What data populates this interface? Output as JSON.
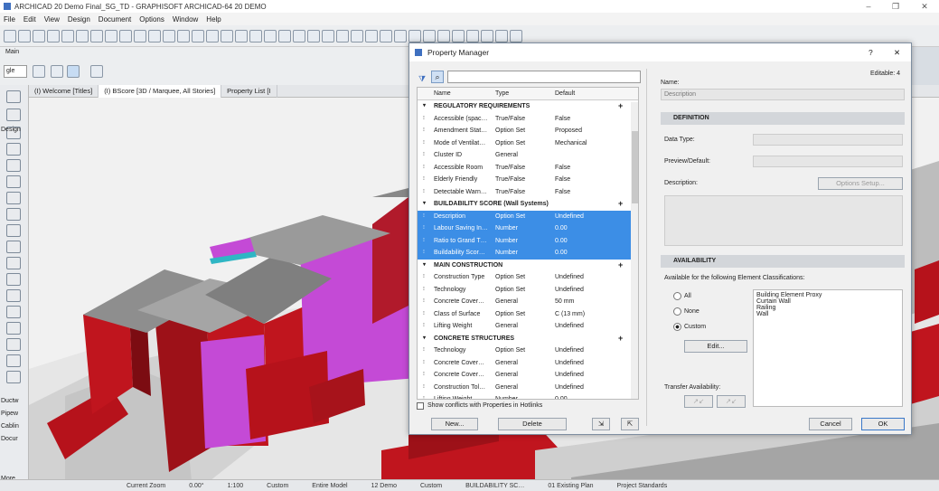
{
  "app": {
    "title": "ARCHICAD 20 Demo Final_SG_TD - GRAPHISOFT ARCHICAD-64 20 DEMO"
  },
  "menu": [
    "File",
    "Edit",
    "View",
    "Design",
    "Document",
    "Options",
    "Window",
    "Help"
  ],
  "toolbar": {
    "main_label": "Main",
    "layer_value": "gle"
  },
  "tabs": [
    "(I) Welcome [Titles]",
    "(I) BScore [3D / Marquee, All Stories]",
    "Property List [I"
  ],
  "palette": {
    "labels": [
      "Design",
      "Ductw",
      "Pipew",
      "Cablin",
      "Docur",
      "More"
    ]
  },
  "dialog": {
    "title": "Property Manager",
    "help": "?",
    "close": "✕",
    "search_placeholder": "",
    "columns": {
      "name": "Name",
      "type": "Type",
      "default": "Default"
    },
    "groups": [
      {
        "name": "REGULATORY REQUIREMENTS",
        "rows": [
          {
            "name": "Accessible (spac…",
            "type": "True/False",
            "def": "False"
          },
          {
            "name": "Amendment Stat…",
            "type": "Option Set",
            "def": "Proposed"
          },
          {
            "name": "Mode of Ventilat…",
            "type": "Option Set",
            "def": "Mechanical"
          },
          {
            "name": "Cluster ID",
            "type": "General",
            "def": ""
          },
          {
            "name": "Accessible Room",
            "type": "True/False",
            "def": "False"
          },
          {
            "name": "Elderly Friendly",
            "type": "True/False",
            "def": "False"
          },
          {
            "name": "Detectable Warn…",
            "type": "True/False",
            "def": "False"
          }
        ]
      },
      {
        "name": "BUILDABILITY SCORE (Wall Systems)",
        "rows": [
          {
            "name": "Description",
            "type": "Option Set",
            "def": "Undefined",
            "sel": true
          },
          {
            "name": "Labour Saving In…",
            "type": "Number",
            "def": "0.00",
            "sel": true
          },
          {
            "name": "Ratio to Grand T…",
            "type": "Number",
            "def": "0.00",
            "sel": true
          },
          {
            "name": "Buildability Scor…",
            "type": "Number",
            "def": "0.00",
            "sel": true
          }
        ]
      },
      {
        "name": "MAIN CONSTRUCTION",
        "rows": [
          {
            "name": "Construction Type",
            "type": "Option Set",
            "def": "Undefined"
          },
          {
            "name": "Technology",
            "type": "Option Set",
            "def": "Undefined"
          },
          {
            "name": "Concrete Cover…",
            "type": "General",
            "def": "50 mm"
          },
          {
            "name": "Class of Surface",
            "type": "Option Set",
            "def": "C (13 mm)"
          },
          {
            "name": "Lifting Weight",
            "type": "General",
            "def": "Undefined"
          }
        ]
      },
      {
        "name": "CONCRETE STRUCTURES",
        "rows": [
          {
            "name": "Technology",
            "type": "Option Set",
            "def": "Undefined"
          },
          {
            "name": "Concrete Cover…",
            "type": "General",
            "def": "Undefined"
          },
          {
            "name": "Concrete Cover…",
            "type": "General",
            "def": "Undefined"
          },
          {
            "name": "Construction Tol…",
            "type": "General",
            "def": "Undefined"
          },
          {
            "name": "Lifting Weight",
            "type": "Number",
            "def": "0.00"
          }
        ]
      }
    ],
    "show_conflicts": "Show conflicts with Properties in Hotlinks",
    "new_btn": "New...",
    "delete_btn": "Delete",
    "name_label": "Name:",
    "editable": "Editable: 4",
    "name_value": "Description",
    "definition": "DEFINITION",
    "data_type": "Data Type:",
    "preview_default": "Preview/Default:",
    "description": "Description:",
    "options_setup": "Options Setup...",
    "availability": "AVAILABILITY",
    "available_for": "Available for the following Element Classifications:",
    "radio_all": "All",
    "radio_none": "None",
    "radio_custom": "Custom",
    "edit_btn": "Edit...",
    "classifications": [
      "Building Element Proxy",
      "Curtain Wall",
      "Railing",
      "Wall"
    ],
    "transfer": "Transfer Availability:",
    "cancel": "Cancel",
    "ok": "OK"
  },
  "status": [
    "Current Zoom",
    "0.00°",
    "1:100",
    "Custom",
    "Entire Model",
    "12 Demo",
    "Custom",
    "BUILDABILITY SC…",
    "01 Existing Plan",
    "Project Standards"
  ],
  "colors": {
    "selection": "#3c8ee6",
    "wall_red": "#c0151e",
    "panel_magenta": "#c44ad6"
  }
}
